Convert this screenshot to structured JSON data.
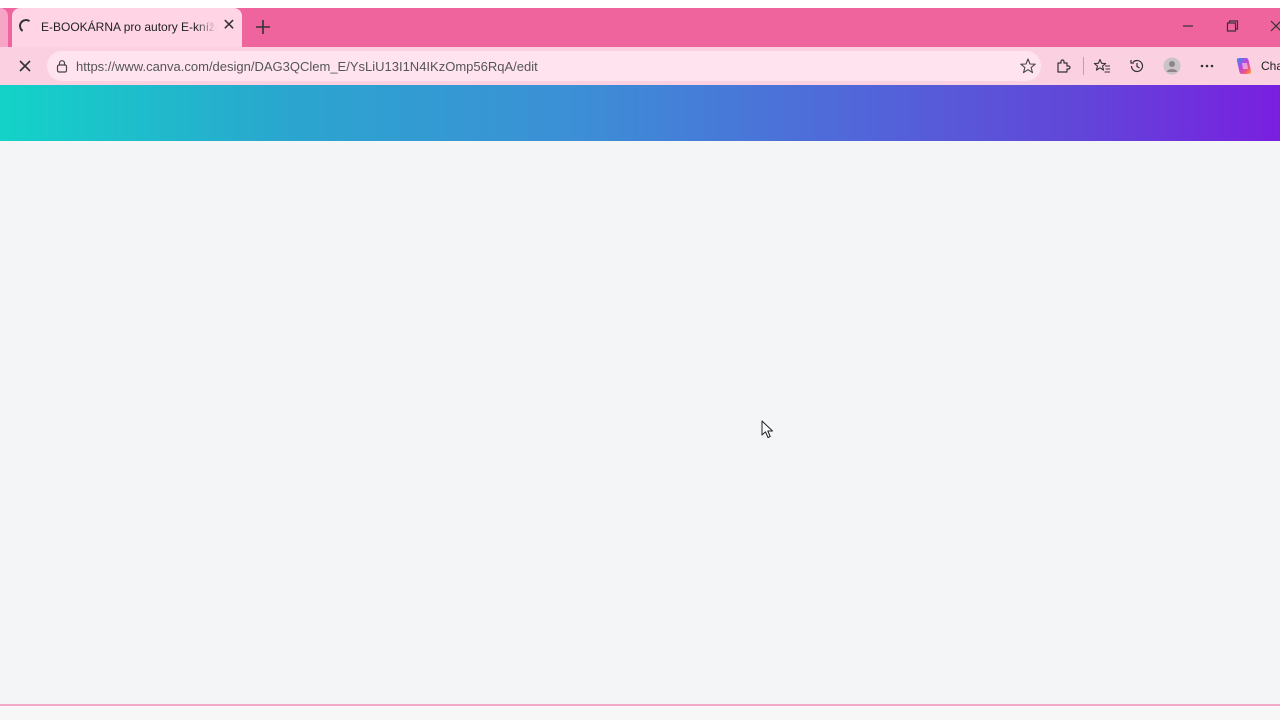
{
  "browser": {
    "tab": {
      "title": "E-BOOKÁRNA pro autory E-knížek",
      "close_glyph": "✕",
      "loading_icon": "loading-spinner-icon"
    },
    "new_tab_icon": "plus-icon",
    "window_controls": [
      "minimize-icon",
      "restore-icon",
      "close-icon"
    ],
    "address_bar": {
      "url": "https://www.canva.com/design/DAG3QClem_E/YsLiU13I1N4IKzOmp56RqA/edit",
      "site_info_icon": "lock-icon",
      "favorite_icon": "star-icon"
    },
    "toolbar": {
      "icons": [
        "extensions-icon",
        "favorites-icon",
        "history-icon",
        "profile-icon",
        "more-icon",
        "copilot-icon"
      ],
      "copilot_label": "Cha"
    }
  },
  "page": {
    "state": "loading",
    "banner_gradient": [
      "#13d3c8",
      "#3c8fd6",
      "#7a1fe0"
    ],
    "background_color": "#f4f5f7"
  },
  "colors": {
    "titlebar": "#f0649e",
    "tab_active": "#ffd5e6",
    "navbar": "#fbd1e2",
    "omnibox": "#ffe4ef"
  }
}
